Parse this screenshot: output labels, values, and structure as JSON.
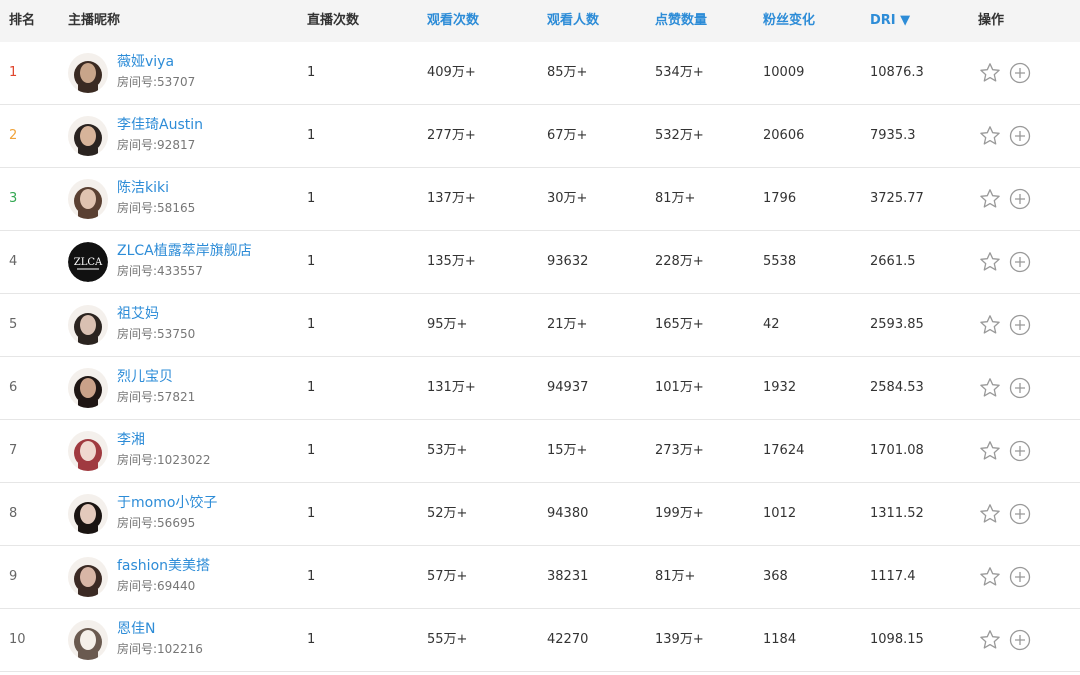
{
  "header": {
    "rank": "排名",
    "name": "主播昵称",
    "live_count": "直播次数",
    "views": "观看次数",
    "viewers": "观看人数",
    "likes": "点赞数量",
    "fans_change": "粉丝变化",
    "dri": "DRI ▼",
    "actions": "操作"
  },
  "colors": {
    "link_blue": "#2d8cd7",
    "rank1": "#e0452c",
    "rank2": "#f0a33a",
    "rank3": "#34a853",
    "header_bg": "#f4f4f4"
  },
  "icons": {
    "favorite": "star-outline-icon",
    "add": "plus-circle-icon"
  },
  "rows": [
    {
      "rank": "1",
      "name": "薇娅viya",
      "room": "房间号:53707",
      "live": "1",
      "views": "409万+",
      "viewers": "85万+",
      "likes": "534万+",
      "fans": "10009",
      "dri": "10876.3"
    },
    {
      "rank": "2",
      "name": "李佳琦Austin",
      "room": "房间号:92817",
      "live": "1",
      "views": "277万+",
      "viewers": "67万+",
      "likes": "532万+",
      "fans": "20606",
      "dri": "7935.3"
    },
    {
      "rank": "3",
      "name": "陈洁kiki",
      "room": "房间号:58165",
      "live": "1",
      "views": "137万+",
      "viewers": "30万+",
      "likes": "81万+",
      "fans": "1796",
      "dri": "3725.77"
    },
    {
      "rank": "4",
      "name": "ZLCA植露萃岸旗舰店",
      "room": "房间号:433557",
      "live": "1",
      "views": "135万+",
      "viewers": "93632",
      "likes": "228万+",
      "fans": "5538",
      "dri": "2661.5"
    },
    {
      "rank": "5",
      "name": "祖艾妈",
      "room": "房间号:53750",
      "live": "1",
      "views": "95万+",
      "viewers": "21万+",
      "likes": "165万+",
      "fans": "42",
      "dri": "2593.85"
    },
    {
      "rank": "6",
      "name": "烈儿宝贝",
      "room": "房间号:57821",
      "live": "1",
      "views": "131万+",
      "viewers": "94937",
      "likes": "101万+",
      "fans": "1932",
      "dri": "2584.53"
    },
    {
      "rank": "7",
      "name": "李湘",
      "room": "房间号:1023022",
      "live": "1",
      "views": "53万+",
      "viewers": "15万+",
      "likes": "273万+",
      "fans": "17624",
      "dri": "1701.08"
    },
    {
      "rank": "8",
      "name": "于momo小饺子",
      "room": "房间号:56695",
      "live": "1",
      "views": "52万+",
      "viewers": "94380",
      "likes": "199万+",
      "fans": "1012",
      "dri": "1311.52"
    },
    {
      "rank": "9",
      "name": "fashion美美搭",
      "room": "房间号:69440",
      "live": "1",
      "views": "57万+",
      "viewers": "38231",
      "likes": "81万+",
      "fans": "368",
      "dri": "1117.4"
    },
    {
      "rank": "10",
      "name": "恩佳N",
      "room": "房间号:102216",
      "live": "1",
      "views": "55万+",
      "viewers": "42270",
      "likes": "139万+",
      "fans": "1184",
      "dri": "1098.15"
    }
  ]
}
